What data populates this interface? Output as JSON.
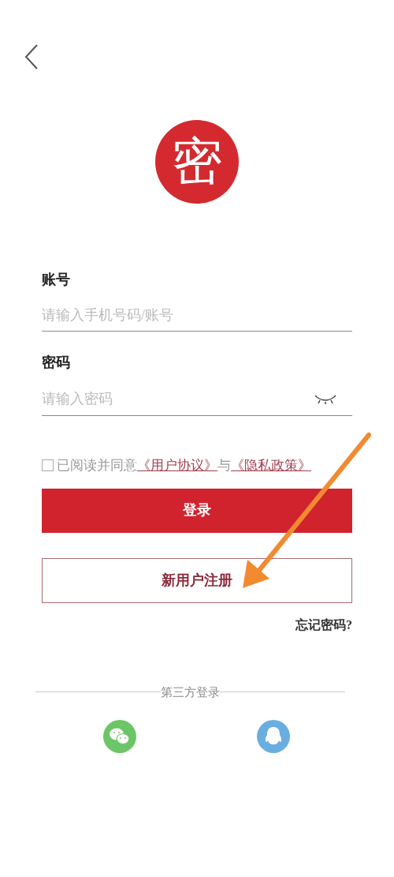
{
  "logo": {
    "text": "密"
  },
  "account": {
    "label": "账号",
    "placeholder": "请输入手机号码/账号"
  },
  "password": {
    "label": "密码",
    "placeholder": "请输入密码",
    "visible": false
  },
  "agreement": {
    "checked": false,
    "text": "已阅读并同意",
    "link_1": "《用户协议》",
    "joiner": "与",
    "link_2": "《隐私政策》"
  },
  "login_button": "登录",
  "register_button": "新用户注册",
  "forgot_password": "忘记密码?",
  "third_party": {
    "title": "第三方登录",
    "providers": [
      {
        "kind": "wechat",
        "color": "#6cc667"
      },
      {
        "kind": "qq",
        "color": "#6aaee0"
      }
    ]
  }
}
